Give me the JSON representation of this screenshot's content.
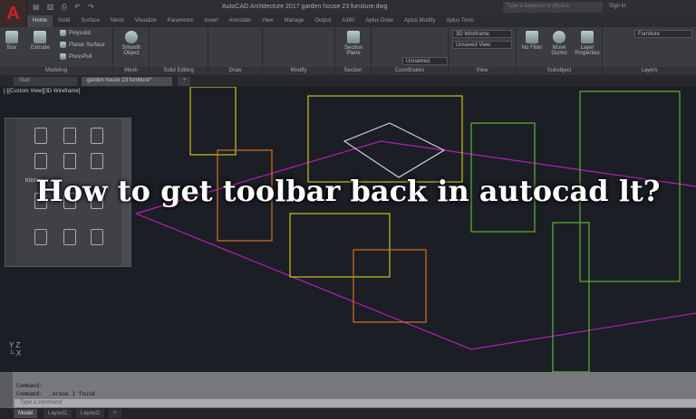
{
  "titlebar": {
    "logo": "A",
    "title": "AutoCAD Architecture 2017   garden house 23 furniture.dwg",
    "search_placeholder": "Type a keyword or phrase",
    "sign_in": "Sign In"
  },
  "ribbon_tabs": [
    "Home",
    "Solid",
    "Surface",
    "Mesh",
    "Visualize",
    "Parametric",
    "Insert",
    "Annotate",
    "View",
    "Manage",
    "Output",
    "A360",
    "Aplus Draw",
    "Aplus Modify",
    "Aplus Tools"
  ],
  "panels": {
    "modeling": "Modeling",
    "mesh": "Mesh",
    "solid_editing": "Solid Editing",
    "draw": "Draw",
    "modify": "Modify",
    "section": "Section",
    "coordinates": "Coordinates",
    "view": "View",
    "subobject": "Subobject",
    "layers": "Layers"
  },
  "buttons": {
    "box": "Box",
    "extrude": "Extrude",
    "polysolid": "Polysolid",
    "planar_surface": "Planar Surface",
    "presspull": "PressPull",
    "smooth_object": "Smooth Object",
    "section_plane": "Section Plane",
    "no_filter": "No Filter",
    "move_gizmo": "Move Gizmo",
    "layer_properties": "Layer Properties"
  },
  "dropdowns": {
    "visual_style": "3D Wireframe",
    "view": "Unsaved View",
    "ucs": "Unnamed",
    "layer": "Furniture"
  },
  "file_tabs": [
    "Start",
    "garden house 23 furniture*"
  ],
  "viewport": {
    "label": "[-][Custom View][3D Wireframe]"
  },
  "palette": {
    "section_label": "Kitchen"
  },
  "headline": "How to get toolbar back in autocad lt?",
  "command": {
    "line1": "Command:",
    "line2": "Command: _.erase 1 found",
    "placeholder": "Type a command"
  },
  "layout_tabs": [
    "Model",
    "Layout1",
    "Layout2"
  ],
  "colors": {
    "wire_yellow": "#c8c020",
    "wire_green": "#60b030",
    "wire_magenta": "#b020b0",
    "wire_orange": "#d07020",
    "wire_white": "#d0d0d0"
  }
}
